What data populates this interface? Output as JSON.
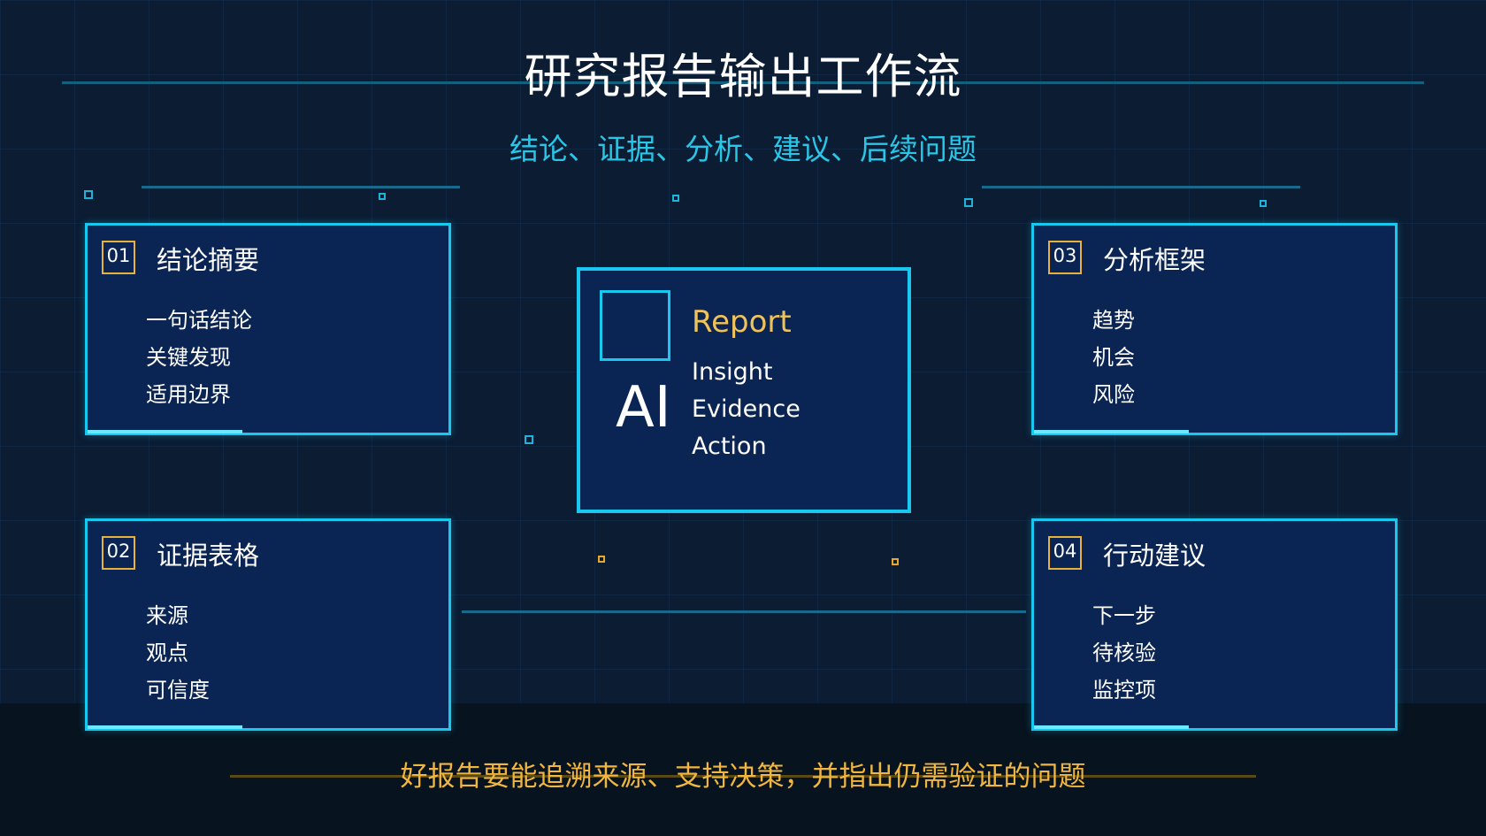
{
  "header": {
    "title": "研究报告输出工作流",
    "subtitle": "结论、证据、分析、建议、后续问题"
  },
  "cards": [
    {
      "number": "01",
      "heading": "结论摘要",
      "items": [
        "一句话结论",
        "关键发现",
        "适用边界"
      ]
    },
    {
      "number": "02",
      "heading": "证据表格",
      "items": [
        "来源",
        "观点",
        "可信度"
      ]
    },
    {
      "number": "03",
      "heading": "分析框架",
      "items": [
        "趋势",
        "机会",
        "风险"
      ]
    },
    {
      "number": "04",
      "heading": "行动建议",
      "items": [
        "下一步",
        "待核验",
        "监控项"
      ]
    }
  ],
  "center": {
    "ai_label": "AI",
    "report_label": "Report",
    "items": [
      "Insight",
      "Evidence",
      "Action"
    ]
  },
  "footer": {
    "text": "好报告要能追溯来源、支持决策，并指出仍需验证的问题"
  },
  "colors": {
    "background": "#0b1c33",
    "card_border": "#18c8ee",
    "card_fill": "#0a2453",
    "accent_gold": "#e8b23a",
    "subtitle_cyan": "#29c6e8",
    "footer_gold": "#f0b640"
  }
}
